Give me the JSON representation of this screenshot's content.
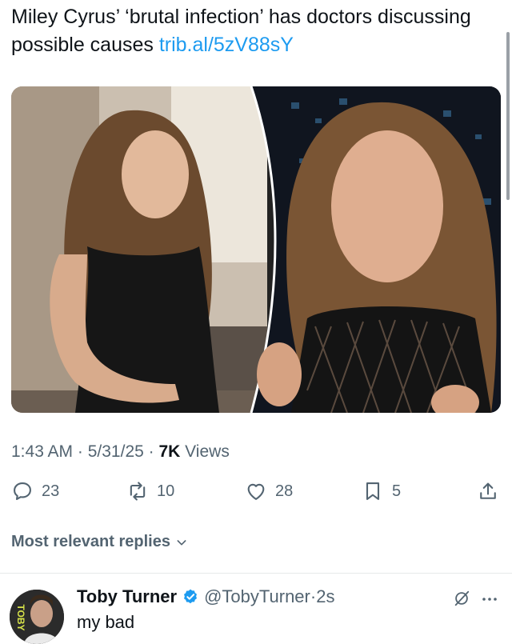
{
  "tweet": {
    "text": "Miley Cyrus’ ‘brutal infection’ has doctors discussing possible causes ",
    "link": "trib.al/5zV88sY"
  },
  "meta": {
    "time": "1:43 AM",
    "sep1": " · ",
    "date": "5/31/25",
    "sep2": " · ",
    "views_count": "7K",
    "views_label": " Views"
  },
  "actions": {
    "replies": "23",
    "reposts": "10",
    "likes": "28",
    "bookmarks": "5"
  },
  "replies_section": {
    "sort_label": "Most relevant replies"
  },
  "reply": {
    "name": "Toby Turner",
    "handle": "@TobyTurner",
    "sep": " · ",
    "time": "2s",
    "text": "my bad",
    "avatar_text": "TOBY"
  },
  "colors": {
    "accent": "#1d9bf0",
    "secondary_text": "#536471",
    "primary_text": "#0f1419"
  },
  "icons": [
    "reply-icon",
    "repost-icon",
    "like-icon",
    "bookmark-icon",
    "share-icon",
    "chevron-down-icon",
    "verified-badge-icon",
    "grok-icon",
    "more-icon"
  ]
}
